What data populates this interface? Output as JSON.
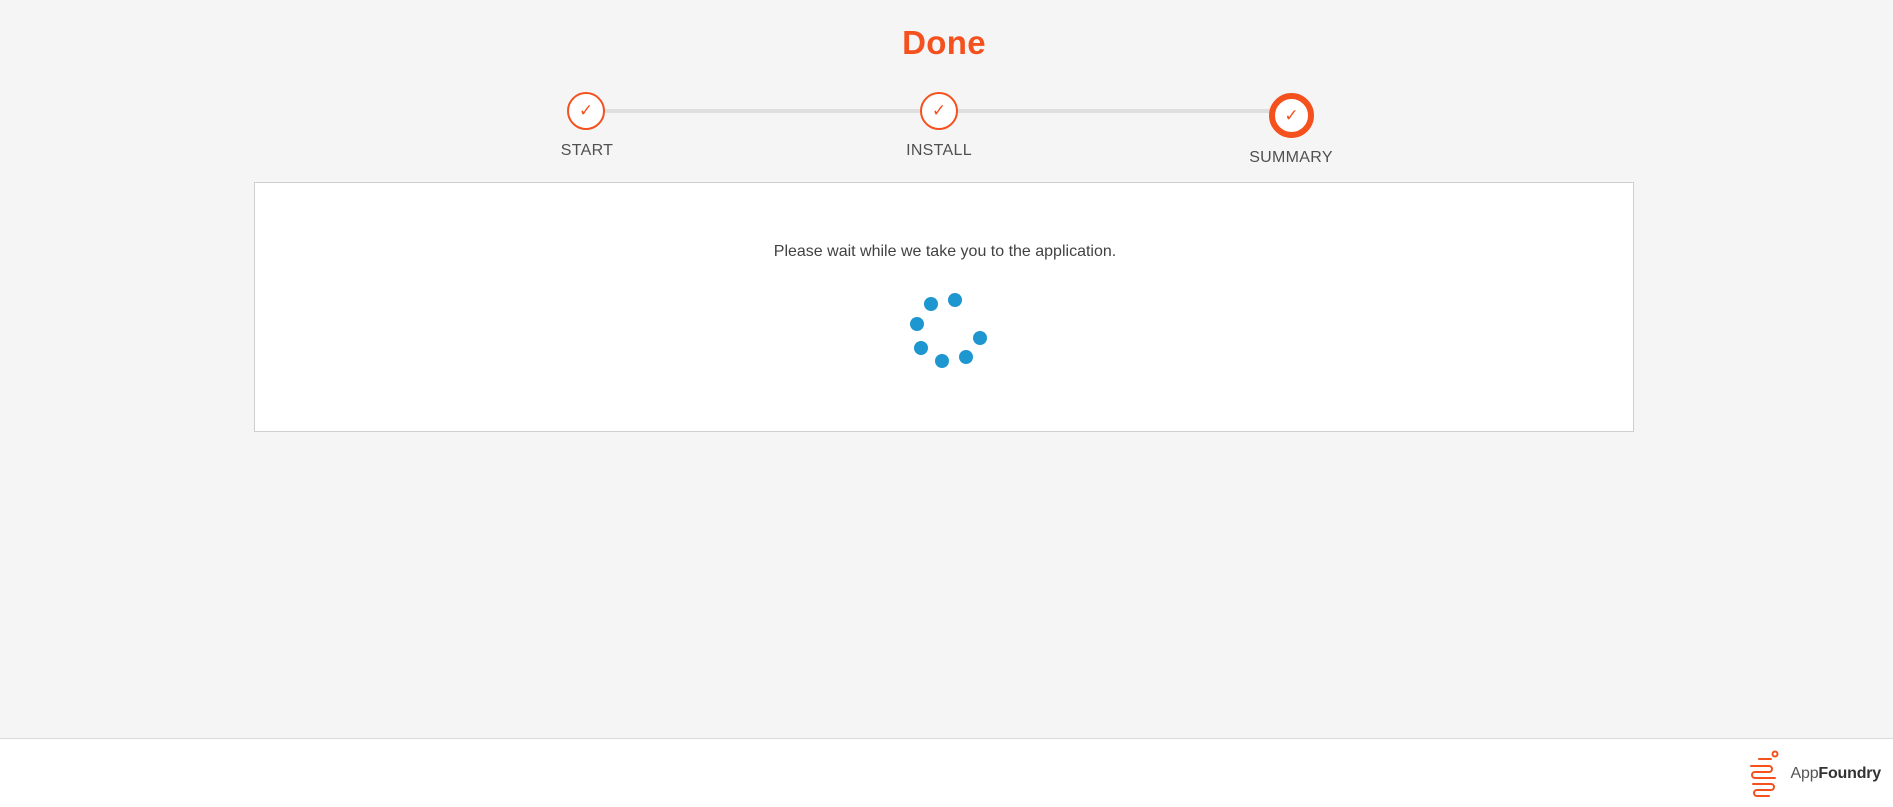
{
  "header": {
    "title": "Done"
  },
  "stepper": {
    "steps": [
      {
        "label": "START",
        "status": "complete",
        "icon": "check-icon",
        "glyph": "✓"
      },
      {
        "label": "INSTALL",
        "status": "complete",
        "icon": "check-icon",
        "glyph": "✓"
      },
      {
        "label": "SUMMARY",
        "status": "current",
        "icon": "check-icon",
        "glyph": "✓"
      }
    ]
  },
  "main": {
    "message": "Please wait while we take you to the application.",
    "spinner_icon": "loading-spinner-icon"
  },
  "footer": {
    "brand_prefix": "App",
    "brand_suffix": "Foundry",
    "logo_icon": "appfoundry-logo-icon"
  },
  "colors": {
    "accent": "#f4511e",
    "spinner": "#1e96d0",
    "background": "#f5f5f5",
    "track": "#dedede"
  }
}
